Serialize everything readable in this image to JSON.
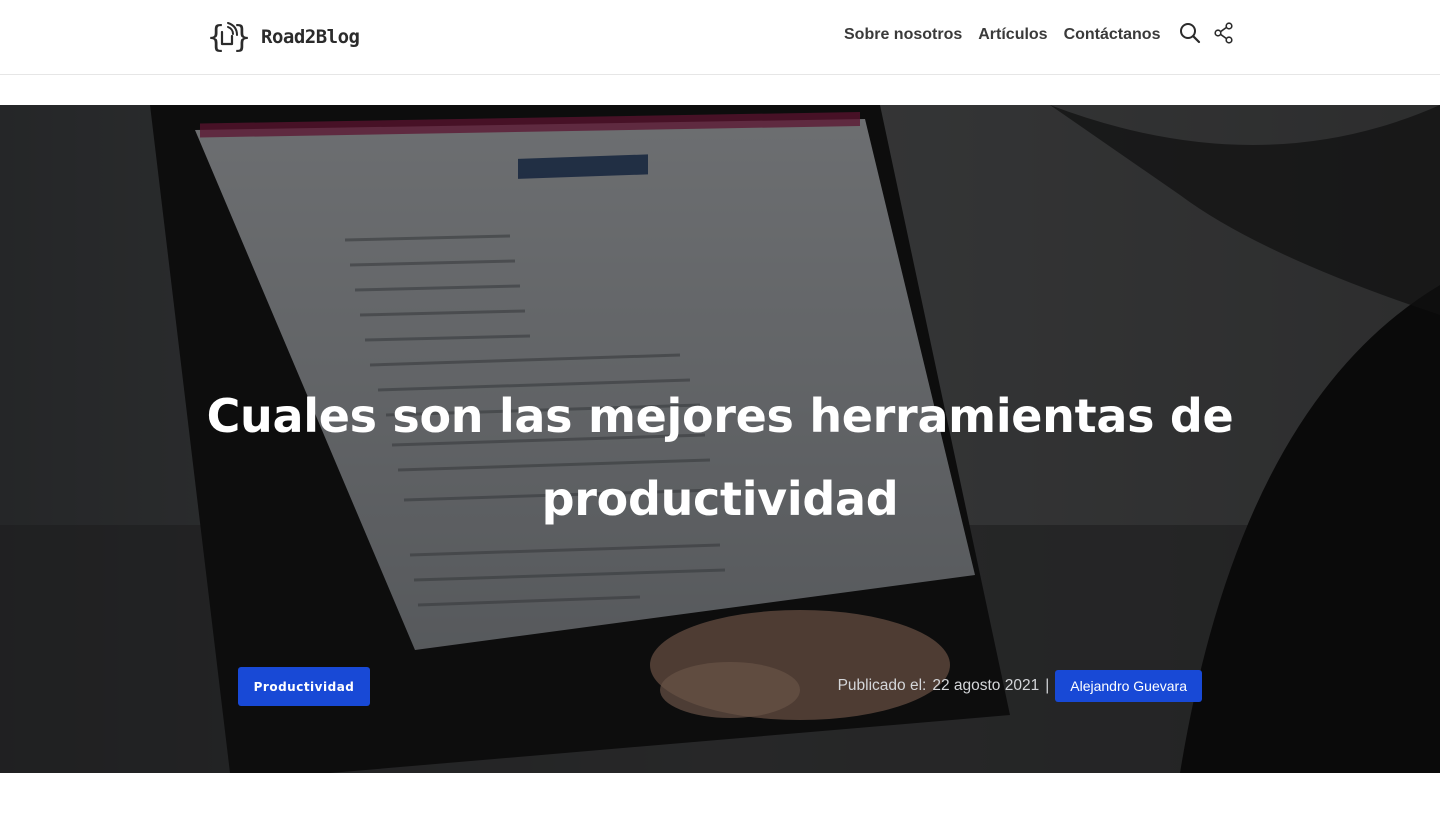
{
  "header": {
    "brand_name": "Road2Blog",
    "nav": [
      {
        "label": "Sobre nosotros"
      },
      {
        "label": "Artículos"
      },
      {
        "label": "Contáctanos"
      }
    ],
    "search_icon": "search-icon",
    "share_icon": "share-icon"
  },
  "hero": {
    "title": "Cuales son las mejores herramientas de productividad",
    "category": "Productividad",
    "published_prefix": "Publicado el:",
    "published_date": "22 agosto 2021",
    "separator": "|",
    "author": "Alejandro Guevara",
    "background_description_icon": "laptop-photo"
  },
  "colors": {
    "accent": "#1849d6",
    "header_text": "#3a3a3a",
    "hero_overlay": "rgba(0,0,0,0.5)"
  }
}
